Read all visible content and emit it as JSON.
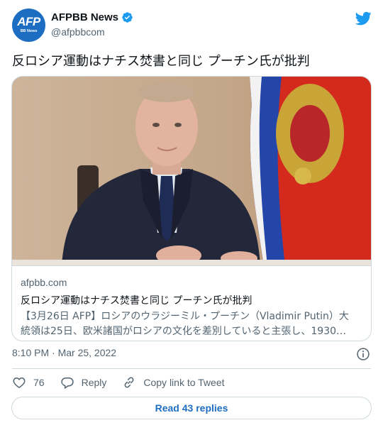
{
  "author": {
    "display_name": "AFPBB News",
    "handle": "@afpbbcom",
    "avatar_logo": "AFP",
    "avatar_sub": "BB News",
    "verified": true
  },
  "icons": {
    "verified": "verified-badge-icon",
    "platform": "twitter-bird-icon",
    "info": "info-icon",
    "like": "heart-icon",
    "reply": "reply-bubble-icon",
    "copy_link": "link-icon"
  },
  "tweet": {
    "text": "反ロシア運動はナチス焚書と同じ プーチン氏が批判",
    "timestamp": "8:10 PM · Mar 25, 2022"
  },
  "card": {
    "domain": "afpbb.com",
    "title": "反ロシア運動はナチス焚書と同じ プーチン氏が批判",
    "description_line1": "【3月26日 AFP】ロシアのウラジーミル・プーチン（Vladimir Putin）大",
    "description_line2": "統領は25日、欧米諸国がロシアの文化を差別していると主張し、1930…"
  },
  "actions": {
    "like_count": "76",
    "reply_label": "Reply",
    "copy_label": "Copy link to Tweet"
  },
  "footer": {
    "read_replies": "Read 43 replies"
  },
  "colors": {
    "brand_blue": "#1d6ec2",
    "twitter_blue": "#1d9bf0",
    "text_primary": "#0f1419",
    "text_secondary": "#536471",
    "border": "#cfd9de"
  }
}
